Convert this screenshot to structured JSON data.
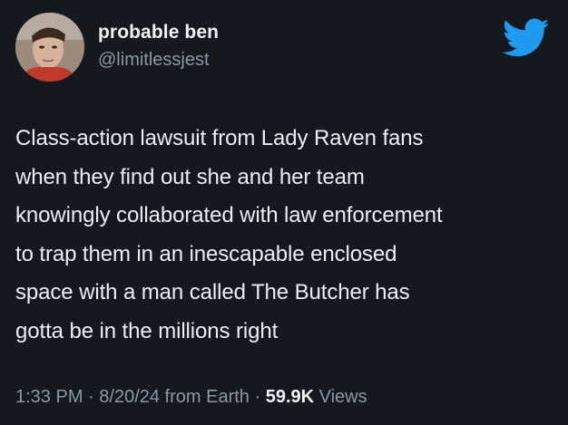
{
  "user": {
    "display_name": "probable ben",
    "handle": "@limitlessjest"
  },
  "icons": {
    "avatar": "profile-photo",
    "platform": "twitter-bird-icon"
  },
  "colors": {
    "background": "#15181d",
    "text": "#e7e9ea",
    "secondary": "#8b98a5",
    "twitter_blue": "#1d9bf0"
  },
  "tweet": {
    "lines": [
      "Class-action lawsuit from Lady Raven fans",
      "when they find out she and her team",
      "knowingly collaborated with law enforcement",
      "to trap them in an inescapable enclosed",
      "space with a man called The Butcher has",
      "gotta be in the millions right"
    ]
  },
  "meta": {
    "time": "1:33 PM",
    "sep1": " · ",
    "date": "8/20/24",
    "source": " from Earth",
    "sep2": " · ",
    "views_count": "59.9K",
    "views_label": " Views"
  }
}
